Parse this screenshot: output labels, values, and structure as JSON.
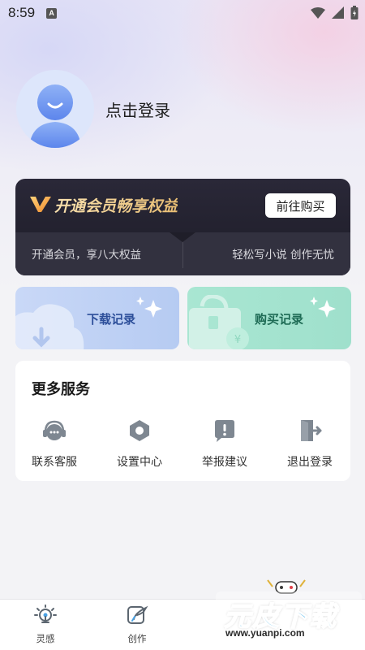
{
  "status_bar": {
    "time": "8:59",
    "notification_badge": "A",
    "icons": [
      "wifi-icon",
      "signal-icon",
      "battery-icon"
    ]
  },
  "profile": {
    "login_text": "点击登录",
    "avatar_icon": "user-avatar-icon"
  },
  "vip": {
    "title": "开通会员畅享权益",
    "button_label": "前往购买",
    "left_text": "开通会员，享八大权益",
    "right_text": "轻松写小说 创作无忧",
    "accent_color": "#e8bd73"
  },
  "records": {
    "download_label": "下载记录",
    "purchase_label": "购买记录"
  },
  "services": {
    "title": "更多服务",
    "items": [
      {
        "label": "联系客服",
        "icon": "customer-service-icon"
      },
      {
        "label": "设置中心",
        "icon": "settings-icon"
      },
      {
        "label": "举报建议",
        "icon": "report-icon"
      },
      {
        "label": "退出登录",
        "icon": "logout-icon"
      }
    ]
  },
  "tabbar": {
    "tabs": [
      {
        "label": "灵感",
        "icon": "bulb-icon"
      },
      {
        "label": "创作",
        "icon": "write-icon"
      }
    ]
  },
  "watermark": {
    "logo_text": "元皮下载",
    "url": "www.yuanpi.com"
  }
}
